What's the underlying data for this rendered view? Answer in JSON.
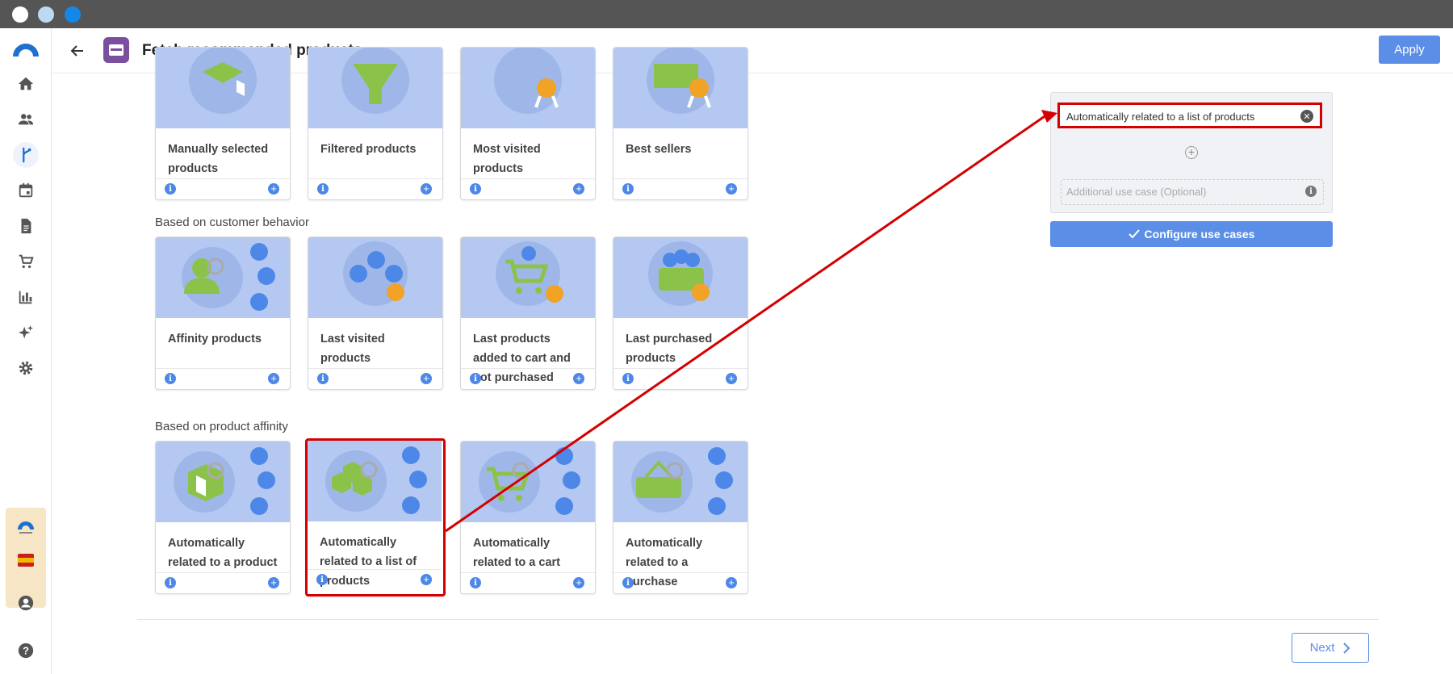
{
  "header": {
    "title": "Fetch recommended products",
    "apply_label": "Apply"
  },
  "sections": {
    "customer_behavior": "Based on customer behavior",
    "product_affinity": "Based on product affinity"
  },
  "cards_row1": [
    {
      "title": "Manually selected products",
      "info": "i",
      "add": "+"
    },
    {
      "title": "Filtered products",
      "info": "i",
      "add": "+"
    },
    {
      "title": "Most visited products",
      "info": "i",
      "add": "+"
    },
    {
      "title": "Best sellers",
      "info": "i",
      "add": "+"
    }
  ],
  "cards_row2": [
    {
      "title": "Affinity products",
      "info": "i",
      "add": "+"
    },
    {
      "title": "Last visited products",
      "info": "i",
      "add": "+"
    },
    {
      "title": "Last products added to cart and not purchased",
      "info": "i",
      "add": "+"
    },
    {
      "title": "Last purchased products",
      "info": "i",
      "add": "+"
    }
  ],
  "cards_row3": [
    {
      "title": "Automatically related to a product",
      "info": "i",
      "add": "+"
    },
    {
      "title": "Automatically related to a list of products",
      "info": "i",
      "add": "+"
    },
    {
      "title": "Automatically related to a cart",
      "info": "i",
      "add": "+"
    },
    {
      "title": "Automatically related to a purchase",
      "info": "i",
      "add": "+"
    }
  ],
  "use_case_panel": {
    "selected": "Automatically related to a list of products",
    "optional_placeholder": "Additional use case (Optional)",
    "configure_label": "Configure use cases"
  },
  "footer": {
    "next_label": "Next"
  },
  "colors": {
    "accent": "#5b8ee6",
    "highlight": "#d40000",
    "card_image_bg": "#b4c8f2"
  }
}
